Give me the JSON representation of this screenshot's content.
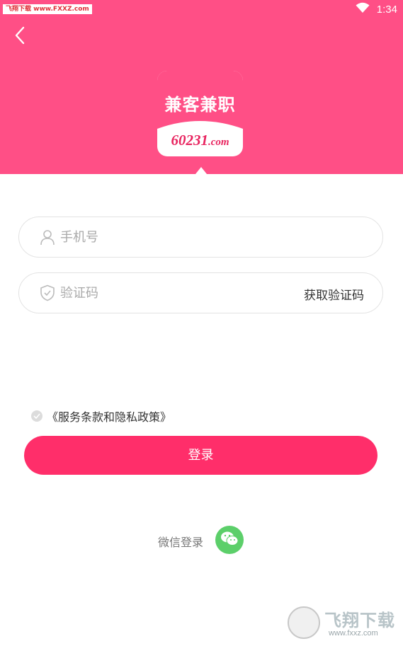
{
  "status_bar": {
    "watermark": "飞翔下载 www.FXXZ.com",
    "time": "1:34"
  },
  "header": {
    "background_color": "#ff4f86",
    "back_icon": "chevron-left-icon"
  },
  "logo": {
    "title": "兼客兼职",
    "domain_num": "60231",
    "domain_suffix": ".com"
  },
  "form": {
    "phone_placeholder": "手机号",
    "phone_icon": "user-icon",
    "code_placeholder": "验证码",
    "code_icon": "shield-icon",
    "get_code_label": "获取验证码"
  },
  "agreement": {
    "label": "《服务条款和隐私政策》"
  },
  "login": {
    "label": "登录",
    "color": "#ff2e6a"
  },
  "wechat": {
    "label": "微信登录",
    "color": "#5ccf6a"
  },
  "watermark_bottom": {
    "text": "飞翔下载",
    "url": "www.fxxz.com"
  }
}
